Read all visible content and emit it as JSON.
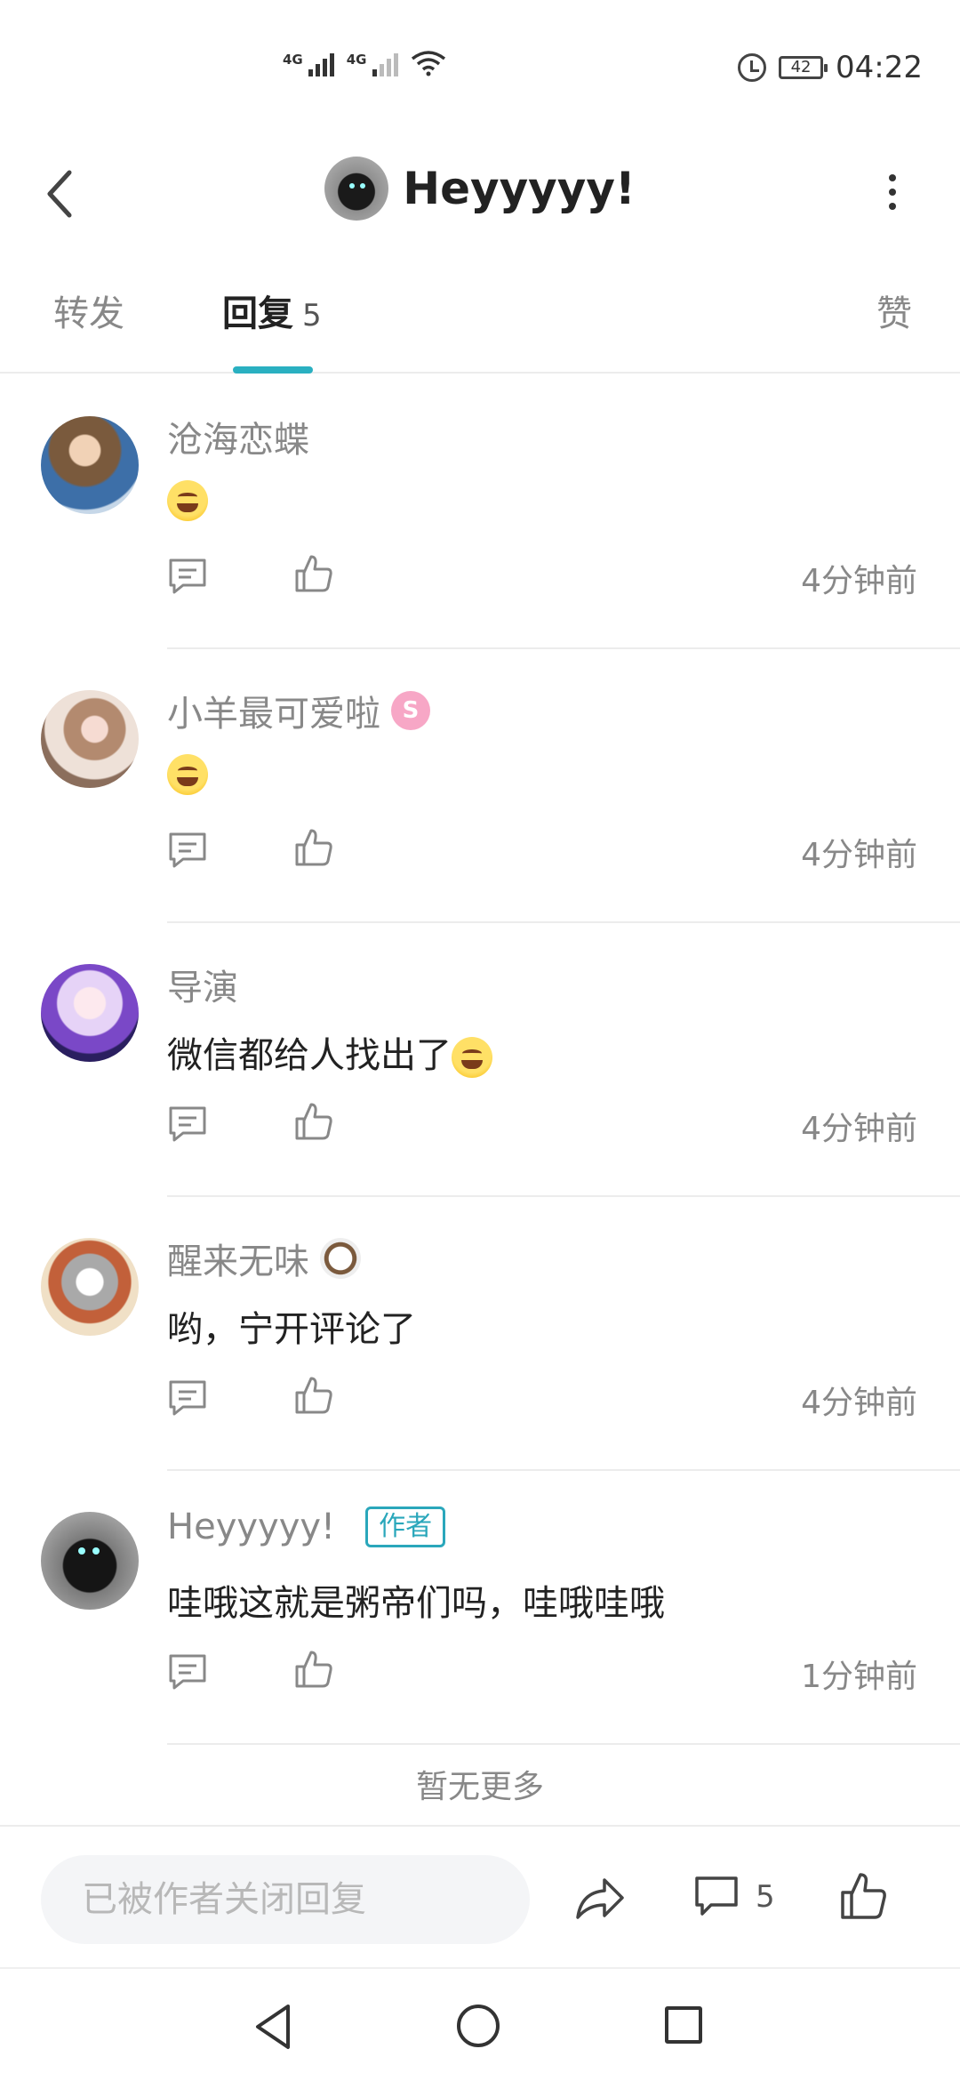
{
  "status_bar": {
    "sim1": "4G",
    "sim2": "4G",
    "battery": "42",
    "time": "04:22"
  },
  "header": {
    "title": "Heyyyyy!"
  },
  "tabs": {
    "forward": "转发",
    "reply": "回复",
    "reply_count": "5",
    "like": "赞"
  },
  "comments": [
    {
      "user": "沧海恋蝶",
      "text": "",
      "emoji": "sweat-smile-emoji",
      "time": "4分钟前"
    },
    {
      "user": "小羊最可爱啦",
      "badge": "S",
      "text": "",
      "emoji": "sweat-smile-emoji",
      "time": "4分钟前"
    },
    {
      "user": "导演",
      "text": "微信都给人找出了",
      "emoji": "yawn-emoji",
      "time": "4分钟前"
    },
    {
      "user": "醒来无味",
      "badge_icon": "cow-badge-icon",
      "text": "哟，宁开评论了",
      "time": "4分钟前"
    },
    {
      "user": "Heyyyyy!",
      "tag": "作者",
      "text": "哇哦这就是粥帝们吗，哇哦哇哦",
      "time": "1分钟前"
    }
  ],
  "footer": {
    "no_more": "暂无更多",
    "input_placeholder": "已被作者关闭回复",
    "comment_count": "5"
  },
  "icons": {
    "back": "chevron-left-icon",
    "more": "more-vertical-icon",
    "reply": "comment-icon",
    "like": "thumbs-up-icon",
    "share": "share-icon"
  },
  "colors": {
    "accent": "#2ab0c1",
    "author_tag": "#2aa7bb",
    "muted_text": "#888888"
  }
}
